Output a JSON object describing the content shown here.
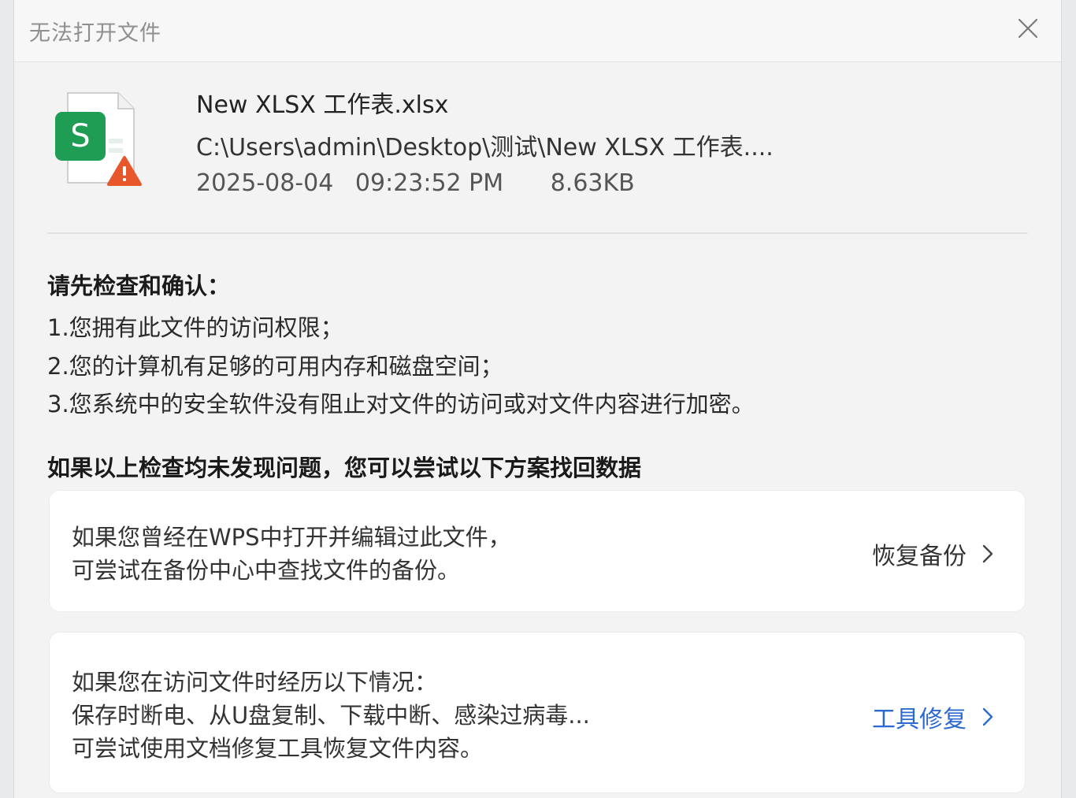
{
  "dialog": {
    "title": "无法打开文件"
  },
  "file": {
    "name": "New XLSX 工作表.xlsx",
    "path": "C:\\Users\\admin\\Desktop\\测试\\New XLSX 工作表....",
    "date": "2025-08-04",
    "time": "09:23:52 PM",
    "size": "8.63KB",
    "icon_letter": "S"
  },
  "checks": {
    "title": "请先检查和确认：",
    "items": [
      "1.您拥有此文件的访问权限；",
      "2.您的计算机有足够的可用内存和磁盘空间；",
      "3.您系统中的安全软件没有阻止对文件的访问或对文件内容进行加密。"
    ]
  },
  "solutions": {
    "title": "如果以上检查均未发现问题，您可以尝试以下方案找回数据",
    "cards": [
      {
        "lines": [
          "如果您曾经在WPS中打开并编辑过此文件，",
          "可尝试在备份中心中查找文件的备份。"
        ],
        "action": "恢复备份"
      },
      {
        "lines": [
          "如果您在访问文件时经历以下情况：",
          "保存时断电、从U盘复制、下载中断、感染过病毒...",
          "可尝试使用文档修复工具恢复文件内容。"
        ],
        "action": "工具修复"
      }
    ]
  },
  "colors": {
    "accent_link": "#2b6ad1",
    "sheet_green": "#1f9d55",
    "warning_orange": "#e8572a"
  }
}
